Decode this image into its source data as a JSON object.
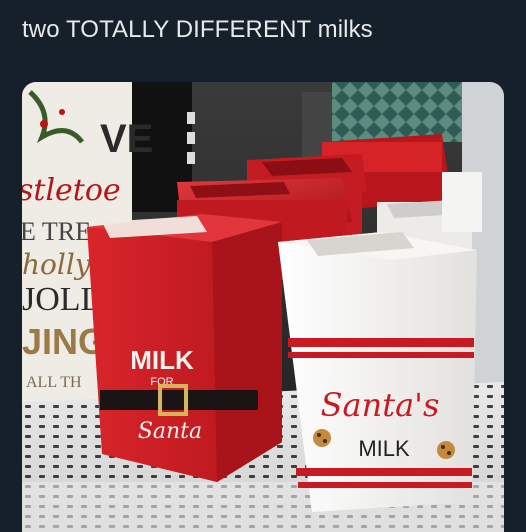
{
  "post": {
    "caption": "two TOTALLY DIFFERENT milks"
  },
  "photo": {
    "sign_text": {
      "line_ve": "VE",
      "line_mistletoe": "stletoe",
      "line_tre": "E TRE",
      "line_holly": "holly",
      "line_jolly": "JOLLY",
      "line_jingle": "JINGL",
      "line_all": "ALL TH"
    },
    "red_carton": {
      "title": "MILK",
      "for": "FOR",
      "name": "Santa"
    },
    "white_carton": {
      "script": "Santa's",
      "label": "MILK"
    },
    "colors": {
      "red": "#c8191e",
      "white_ceramic": "#f3f1ee",
      "belt": "#1b1414",
      "buckle": "#d6b55a",
      "cookie": "#c48a3c"
    }
  }
}
